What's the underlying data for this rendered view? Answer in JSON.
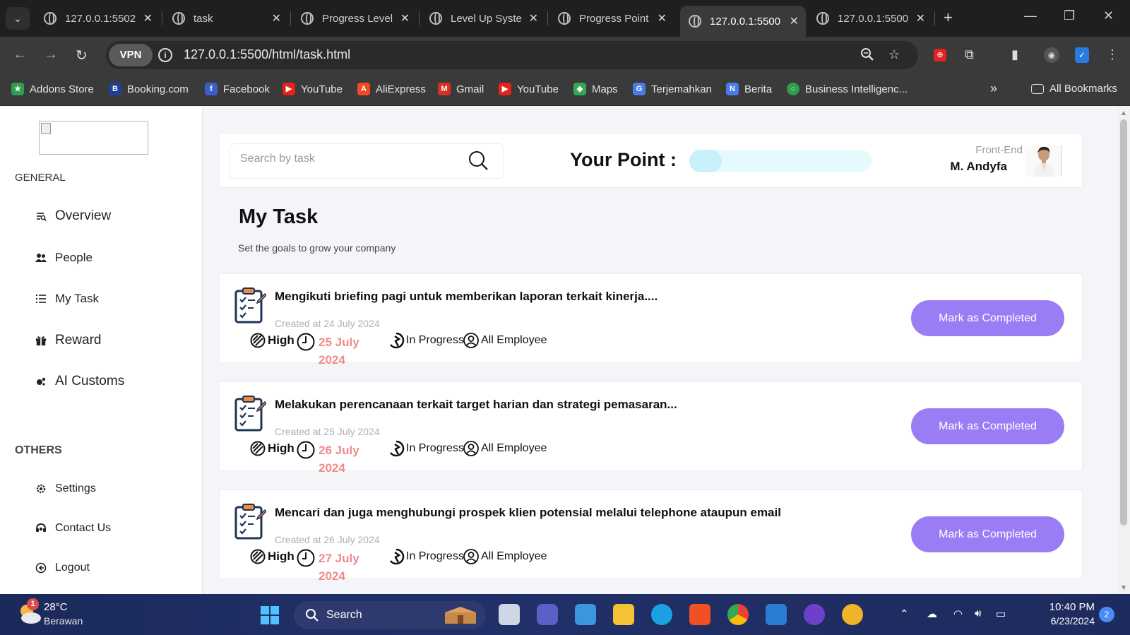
{
  "browser": {
    "tabs": [
      {
        "title": "127.0.0.1:5502",
        "active": false
      },
      {
        "title": "task",
        "active": false
      },
      {
        "title": "Progress Level",
        "active": false
      },
      {
        "title": "Level Up Syste",
        "active": false
      },
      {
        "title": "Progress Point",
        "active": false
      },
      {
        "title": "127.0.0.1:5500",
        "active": true
      },
      {
        "title": "127.0.0.1:5500",
        "active": false
      }
    ],
    "vpn_label": "VPN",
    "url": "127.0.0.1:5500/html/task.html",
    "bookmarks": [
      {
        "label": "Addons Store",
        "color": "#2e9e4f"
      },
      {
        "label": "Booking.com",
        "color": "#1f3f9a"
      },
      {
        "label": "Facebook",
        "color": "#3b5fc8"
      },
      {
        "label": "YouTube",
        "color": "#e62117"
      },
      {
        "label": "AliExpress",
        "color": "#f04a24"
      },
      {
        "label": "Gmail",
        "color": "#d93025"
      },
      {
        "label": "YouTube",
        "color": "#e62117"
      },
      {
        "label": "Maps",
        "color": "#34a853"
      },
      {
        "label": "Terjemahkan",
        "color": "#4a7be8"
      },
      {
        "label": "Berita",
        "color": "#4a7be8"
      },
      {
        "label": "Business Intelligenc...",
        "color": "#2e9e4f"
      }
    ],
    "more_bookmarks": "»",
    "all_bookmarks": "All Bookmarks"
  },
  "sidebar": {
    "general_label": "GENERAL",
    "general_items": [
      {
        "label": "Overview",
        "icon": "overview-icon"
      },
      {
        "label": "People",
        "icon": "people-icon"
      },
      {
        "label": "My Task",
        "icon": "list-icon"
      },
      {
        "label": "Reward",
        "icon": "gift-icon"
      },
      {
        "label": "AI Customs",
        "icon": "ai-icon"
      }
    ],
    "others_label": "OTHERS",
    "others_items": [
      {
        "label": "Settings",
        "icon": "gear-icon"
      },
      {
        "label": "Contact Us",
        "icon": "contact-icon"
      },
      {
        "label": "Logout",
        "icon": "logout-icon"
      }
    ]
  },
  "header": {
    "search_placeholder": "Search by task",
    "point_label": "Your Point :",
    "point_progress": 0.18,
    "role": "Front-End",
    "user_name": "M. Andyfa"
  },
  "main": {
    "title": "My Task",
    "subtitle": "Set the goals to grow your company"
  },
  "tasks": [
    {
      "title": "Mengikuti briefing pagi untuk memberikan laporan terkait kinerja....",
      "created": "Created at 24 July 2024",
      "priority": "High",
      "due_line1": "25 July",
      "due_line2": "2024",
      "status": "In Progress",
      "assignee": "All Employee",
      "button": "Mark as Completed"
    },
    {
      "title": "Melakukan perencanaan terkait target harian dan strategi pemasaran...",
      "created": "Created at 25 July 2024",
      "priority": "High",
      "due_line1": "26 July",
      "due_line2": "2024",
      "status": "In Progress",
      "assignee": "All Employee",
      "button": "Mark as Completed"
    },
    {
      "title": "Mencari dan juga menghubungi prospek klien potensial melalui telephone ataupun email",
      "created": "Created at 26 July 2024",
      "priority": "High",
      "due_line1": "27 July",
      "due_line2": "2024",
      "status": "In Progress",
      "assignee": "All Employee",
      "button": "Mark as Completed"
    }
  ],
  "taskbar": {
    "weather_badge": "1",
    "temperature": "28°C",
    "condition": "Berawan",
    "search_label": "Search",
    "time": "10:40 PM",
    "date": "6/23/2024",
    "notifications": "2"
  }
}
